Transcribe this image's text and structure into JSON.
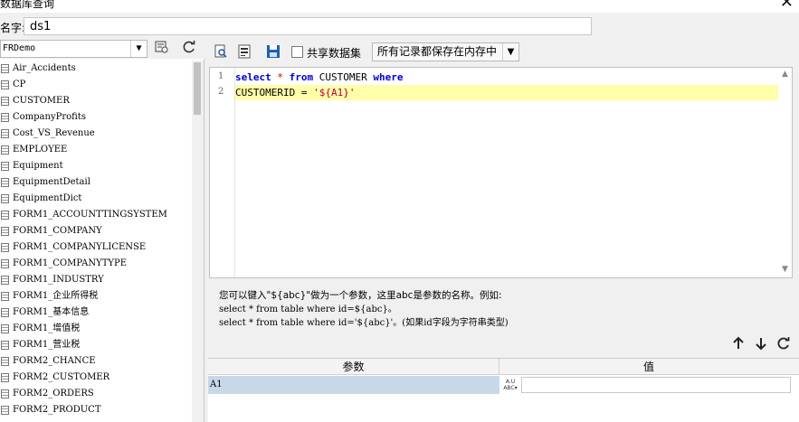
{
  "window": {
    "title": "数据库查询",
    "close_glyph": "✕"
  },
  "name_field": {
    "label": "名字:",
    "value": "ds1"
  },
  "datasource": {
    "selected": "FRDemo"
  },
  "tables": [
    "Air_Accidents",
    "CP",
    "CUSTOMER",
    "CompanyProfits",
    "Cost_VS_Revenue",
    "EMPLOYEE",
    "Equipment",
    "EquipmentDetail",
    "EquipmentDict",
    "FORM1_ACCOUNTTINGSYSTEM",
    "FORM1_COMPANY",
    "FORM1_COMPANYLICENSE",
    "FORM1_COMPANYTYPE",
    "FORM1_INDUSTRY",
    "FORM1_企业所得税",
    "FORM1_基本信息",
    "FORM1_增值税",
    "FORM1_营业税",
    "FORM2_CHANCE",
    "FORM2_CUSTOMER",
    "FORM2_ORDERS",
    "FORM2_PRODUCT"
  ],
  "toolbar": {
    "share_label": "共享数据集",
    "memory_option": "所有记录都保存在内存中"
  },
  "editor": {
    "line_numbers": [
      "1",
      "2"
    ],
    "line1": {
      "kw1": "select",
      "star": "*",
      "kw2": "from",
      "table": "CUSTOMER",
      "kw3": "where"
    },
    "line2": {
      "field": "CUSTOMERID",
      "eq": "=",
      "value": "'${A1}'"
    }
  },
  "hint": {
    "line1": "您可以键入\"${abc}\"做为一个参数，这里abc是参数的名称。例如:",
    "line2": "select * from table where id=${abc}。",
    "line3": "select * from table where id='${abc}'。(如果id字段为字符串类型)"
  },
  "params_table": {
    "col_param": "参数",
    "col_value": "值",
    "rows": [
      {
        "name": "A1",
        "value": ""
      }
    ]
  }
}
